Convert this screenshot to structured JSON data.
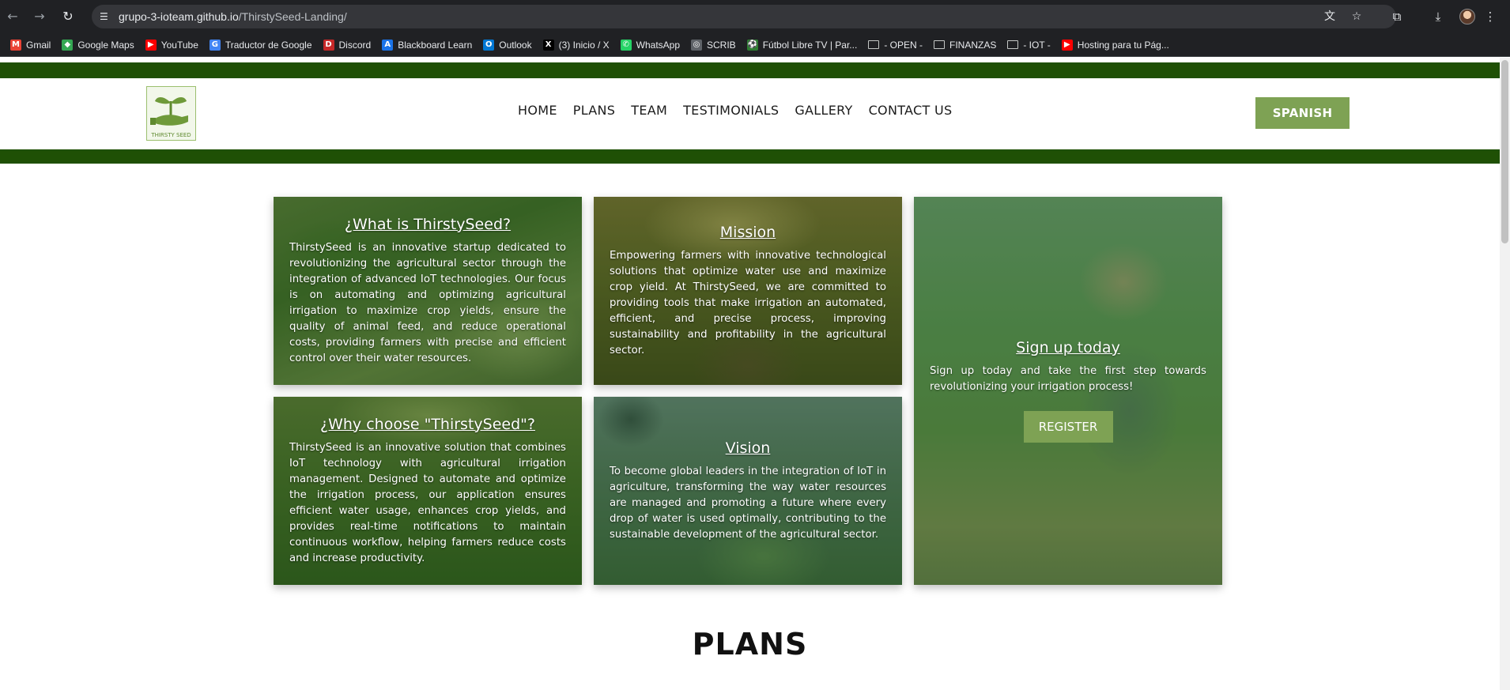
{
  "browser": {
    "url_host": "grupo-3-ioteam.github.io",
    "url_path": "/ThirstySeed-Landing/",
    "bookmarks": [
      {
        "label": "Gmail",
        "icon": "gmail-icon",
        "color": "#ea4335",
        "glyph": "M"
      },
      {
        "label": "Google Maps",
        "icon": "maps-icon",
        "color": "#34a853",
        "glyph": "◆"
      },
      {
        "label": "YouTube",
        "icon": "youtube-icon",
        "color": "#ff0000",
        "glyph": "▶"
      },
      {
        "label": "Traductor de Google",
        "icon": "translate-icon",
        "color": "#4285f4",
        "glyph": "G"
      },
      {
        "label": "Discord",
        "icon": "discord-icon",
        "color": "#c62828",
        "glyph": "D"
      },
      {
        "label": "Blackboard Learn",
        "icon": "blackboard-icon",
        "color": "#1a73e8",
        "glyph": "A"
      },
      {
        "label": "Outlook",
        "icon": "outlook-icon",
        "color": "#0078d4",
        "glyph": "O"
      },
      {
        "label": "(3) Inicio / X",
        "icon": "x-icon",
        "color": "#000000",
        "glyph": "X"
      },
      {
        "label": "WhatsApp",
        "icon": "whatsapp-icon",
        "color": "#25d366",
        "glyph": "✆"
      },
      {
        "label": "SCRIB",
        "icon": "globe-icon",
        "color": "#5f6368",
        "glyph": "◎"
      },
      {
        "label": "Fútbol Libre TV | Par...",
        "icon": "football-icon",
        "color": "#2e7d32",
        "glyph": "⚽"
      },
      {
        "label": "- OPEN -",
        "icon": "folder-icon",
        "folder": true
      },
      {
        "label": "FINANZAS",
        "icon": "folder-icon",
        "folder": true
      },
      {
        "label": "- IOT -",
        "icon": "folder-icon",
        "folder": true
      },
      {
        "label": "Hosting para tu Pág...",
        "icon": "youtube-icon",
        "color": "#ff0000",
        "glyph": "▶"
      }
    ]
  },
  "header": {
    "logo_text": "THIRSTY SEED",
    "nav": [
      "HOME",
      "PLANS",
      "TEAM",
      "TESTIMONIALS",
      "GALLERY",
      "CONTACT US"
    ],
    "lang_button": "SPANISH"
  },
  "cards": {
    "what": {
      "title": "¿What is ThirstySeed?",
      "text": "ThirstySeed is an innovative startup dedicated to revolutionizing the agricultural sector through the integration of advanced IoT technologies. Our focus is on automating and optimizing agricultural irrigation to maximize crop yields, ensure the quality of animal feed, and reduce operational costs, providing farmers with precise and efficient control over their water resources."
    },
    "mission": {
      "title": "Mission",
      "text": "Empowering farmers with innovative technological solutions that optimize water use and maximize crop yield. At ThirstySeed, we are committed to providing tools that make irrigation an automated, efficient, and precise process, improving sustainability and profitability in the agricultural sector."
    },
    "signup": {
      "title": "Sign up today",
      "text": "Sign up today and take the first step towards revolutionizing your irrigation process!",
      "button": "REGISTER"
    },
    "why": {
      "title": "¿Why choose \"ThirstySeed\"?",
      "text": "ThirstySeed is an innovative solution that combines IoT technology with agricultural irrigation management. Designed to automate and optimize the irrigation process, our application ensures efficient water usage, enhances crop yields, and provides real-time notifications to maintain continuous workflow, helping farmers reduce costs and increase productivity."
    },
    "vision": {
      "title": "Vision",
      "text": "To become global leaders in the integration of IoT in agriculture, transforming the way water resources are managed and promoting a future where every drop of water is used optimally, contributing to the sustainable development of the agricultural sector."
    }
  },
  "sections": {
    "plans_title": "PLANS"
  },
  "colors": {
    "brand_dark_green": "#1f5005",
    "accent_green": "#7ea254"
  }
}
